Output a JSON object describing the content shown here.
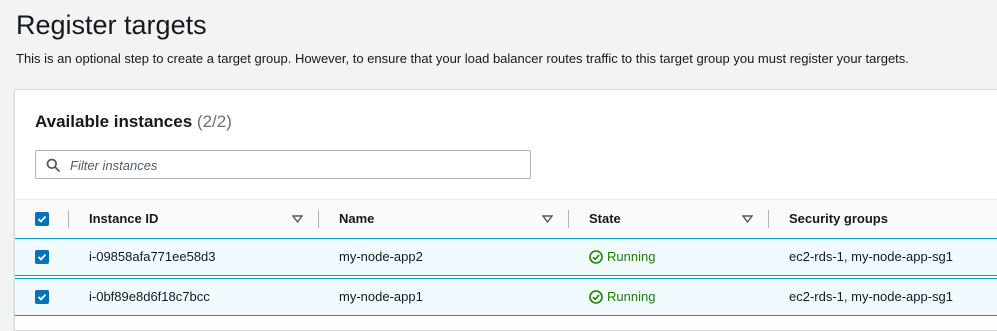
{
  "page": {
    "title": "Register targets",
    "description": "This is an optional step to create a target group. However, to ensure that your load balancer routes traffic to this target group you must register your targets."
  },
  "panel": {
    "title": "Available instances",
    "count": "(2/2)",
    "search_placeholder": "Filter instances"
  },
  "table": {
    "columns": [
      "Instance ID",
      "Name",
      "State",
      "Security groups"
    ],
    "header_checked": true,
    "rows": [
      {
        "selected": true,
        "instance_id": "i-09858afa771ee58d3",
        "name": "my-node-app2",
        "state": "Running",
        "security_groups": "ec2-rds-1, my-node-app-sg1"
      },
      {
        "selected": true,
        "instance_id": "i-0bf89e8d6f18c7bcc",
        "name": "my-node-app1",
        "state": "Running",
        "security_groups": "ec2-rds-1, my-node-app-sg1"
      }
    ]
  },
  "icons": {
    "search": "search-icon",
    "sort": "caret-down-icon",
    "checkbox": "check-icon",
    "status": "check-circle-icon"
  },
  "colors": {
    "accent": "#0073bb",
    "running": "#1d8102",
    "selected_row_bg": "#f1faff",
    "selected_row_border": "#00a1c9"
  }
}
